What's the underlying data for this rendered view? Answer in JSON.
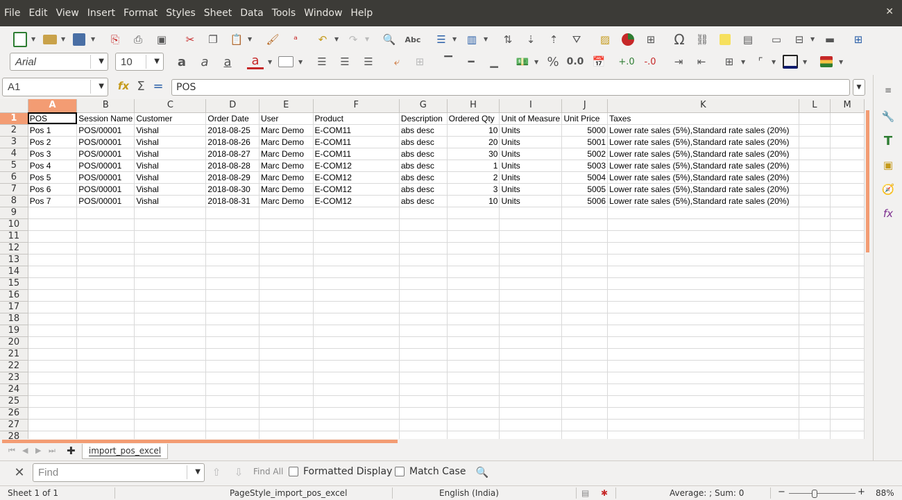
{
  "menu": [
    "File",
    "Edit",
    "View",
    "Insert",
    "Format",
    "Styles",
    "Sheet",
    "Data",
    "Tools",
    "Window",
    "Help"
  ],
  "window": {
    "close_glyph": "✕"
  },
  "font": {
    "name": "Arial",
    "size": "10"
  },
  "formula_bar": {
    "cell_ref": "A1",
    "content": "POS"
  },
  "columns": [
    "A",
    "B",
    "C",
    "D",
    "E",
    "F",
    "G",
    "H",
    "I",
    "J",
    "K",
    "L",
    "M"
  ],
  "headers": [
    "POS",
    "Session Name",
    "Customer",
    "Order Date",
    "User",
    "Product",
    "Description",
    "Ordered Qty",
    "Unit of Measure",
    "Unit Price",
    "Taxes"
  ],
  "rows": [
    [
      "Pos 1",
      "POS/00001",
      "Vishal",
      "2018-08-25",
      "Marc Demo",
      "E-COM11",
      "abs desc",
      "10",
      "Units",
      "5000",
      "Lower rate sales (5%),Standard rate sales (20%)"
    ],
    [
      "Pos 2",
      "POS/00001",
      "Vishal",
      "2018-08-26",
      "Marc Demo",
      "E-COM11",
      "abs desc",
      "20",
      "Units",
      "5001",
      "Lower rate sales (5%),Standard rate sales (20%)"
    ],
    [
      "Pos 3",
      "POS/00001",
      "Vishal",
      "2018-08-27",
      "Marc Demo",
      "E-COM11",
      "abs desc",
      "30",
      "Units",
      "5002",
      "Lower rate sales (5%),Standard rate sales (20%)"
    ],
    [
      "Pos 4",
      "POS/00001",
      "Vishal",
      "2018-08-28",
      "Marc Demo",
      "E-COM12",
      "abs desc",
      "1",
      "Units",
      "5003",
      "Lower rate sales (5%),Standard rate sales (20%)"
    ],
    [
      "Pos 5",
      "POS/00001",
      "Vishal",
      "2018-08-29",
      "Marc Demo",
      "E-COM12",
      "abs desc",
      "2",
      "Units",
      "5004",
      "Lower rate sales (5%),Standard rate sales (20%)"
    ],
    [
      "Pos 6",
      "POS/00001",
      "Vishal",
      "2018-08-30",
      "Marc Demo",
      "E-COM12",
      "abs desc",
      "3",
      "Units",
      "5005",
      "Lower rate sales (5%),Standard rate sales (20%)"
    ],
    [
      "Pos 7",
      "POS/00001",
      "Vishal",
      "2018-08-31",
      "Marc Demo",
      "E-COM12",
      "abs desc",
      "10",
      "Units",
      "5006",
      "Lower rate sales (5%),Standard rate sales (20%)"
    ]
  ],
  "row_numbers": [
    "1",
    "2",
    "3",
    "4",
    "5",
    "6",
    "7",
    "8",
    "9",
    "10",
    "11",
    "12",
    "13",
    "14",
    "15",
    "16",
    "17",
    "18",
    "19",
    "20",
    "21",
    "22",
    "23",
    "24",
    "25",
    "26",
    "27",
    "28"
  ],
  "sheet_tab": "import_pos_excel",
  "find": {
    "placeholder": "Find",
    "find_all": "Find All",
    "formatted_display": "Formatted Display",
    "match_case": "Match Case"
  },
  "status": {
    "sheet": "Sheet 1 of 1",
    "page_style": "PageStyle_import_pos_excel",
    "language": "English (India)",
    "summary": "Average: ; Sum: 0",
    "zoom": "88%"
  },
  "colors": {
    "accent": "#f39c73",
    "menubar": "#3c3b37"
  }
}
